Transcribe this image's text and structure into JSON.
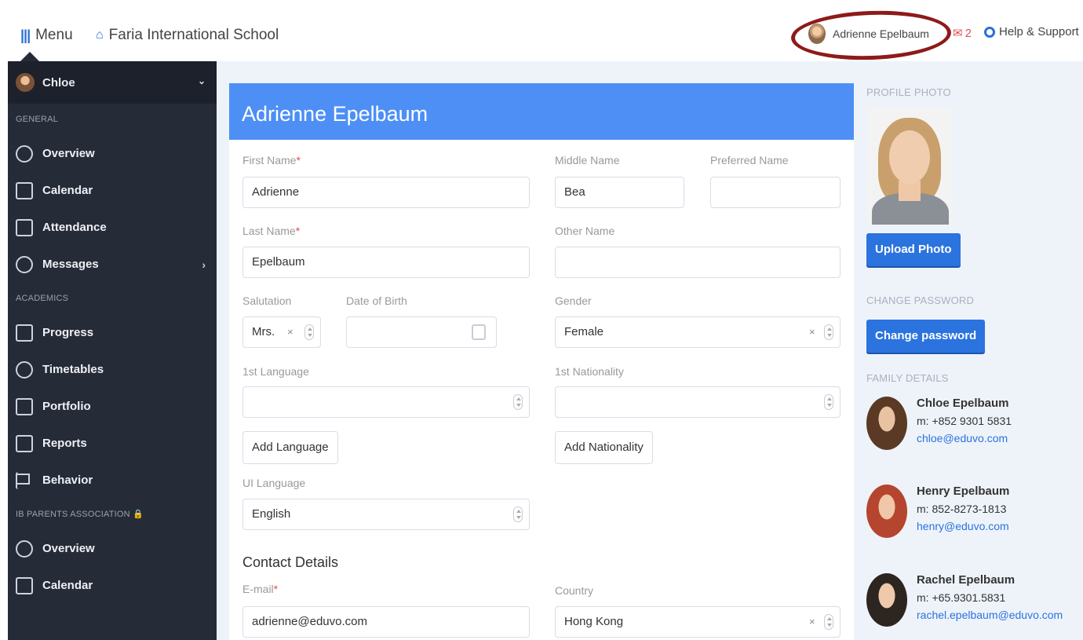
{
  "topbar": {
    "menu_label": "Menu",
    "school_name": "Faria International School",
    "user_name": "Adrienne Epelbaum",
    "notification_count": "2",
    "help_label": "Help & Support"
  },
  "sidebar": {
    "user": "Chloe",
    "sections": {
      "general": "GENERAL",
      "academics": "ACADEMICS",
      "association": "IB PARENTS ASSOCIATION 🔒"
    },
    "general_items": [
      "Overview",
      "Calendar",
      "Attendance",
      "Messages"
    ],
    "academic_items": [
      "Progress",
      "Timetables",
      "Portfolio",
      "Reports",
      "Behavior"
    ],
    "association_items": [
      "Overview",
      "Calendar"
    ]
  },
  "form": {
    "title": "Adrienne Epelbaum",
    "first_name": {
      "label": "First Name",
      "value": "Adrienne"
    },
    "middle_name": {
      "label": "Middle Name",
      "value": "Bea"
    },
    "preferred_name": {
      "label": "Preferred Name",
      "value": ""
    },
    "last_name": {
      "label": "Last Name",
      "value": "Epelbaum"
    },
    "other_name": {
      "label": "Other Name",
      "value": ""
    },
    "salutation": {
      "label": "Salutation",
      "value": "Mrs."
    },
    "dob": {
      "label": "Date of Birth",
      "value": ""
    },
    "gender": {
      "label": "Gender",
      "value": "Female"
    },
    "first_language": {
      "label": "1st Language",
      "value": ""
    },
    "first_nationality": {
      "label": "1st Nationality",
      "value": ""
    },
    "add_language": "Add Language",
    "add_nationality": "Add Nationality",
    "ui_language": {
      "label": "UI Language",
      "value": "English"
    },
    "contact_heading": "Contact Details",
    "email": {
      "label": "E-mail",
      "value": "adrienne@eduvo.com"
    },
    "country": {
      "label": "Country",
      "value": "Hong Kong"
    },
    "required_mark": "*",
    "clear_mark": "×"
  },
  "right_panel": {
    "profile_photo_title": "PROFILE PHOTO",
    "upload_button": "Upload Photo",
    "change_password_title": "CHANGE PASSWORD",
    "change_password_button": "Change password",
    "family_title": "FAMILY DETAILS",
    "family": [
      {
        "name": "Chloe Epelbaum",
        "phone": "m: +852 9301 5831",
        "email": "chloe@eduvo.com"
      },
      {
        "name": "Henry Epelbaum",
        "phone": "m: 852-8273-1813",
        "email": "henry@eduvo.com"
      },
      {
        "name": "Rachel Epelbaum",
        "phone": "m: +65.9301.5831",
        "email": "rachel.epelbaum@eduvo.com"
      }
    ]
  },
  "colors": {
    "accent": "#4d8ff5",
    "button_blue": "#2b73de",
    "sidebar": "#262b38",
    "highlight": "#8e1a1a"
  },
  "icons": [
    "menu-bars-icon",
    "home-icon",
    "mail-icon",
    "help-icon",
    "chevron-down-icon",
    "chevron-right-icon",
    "overview-icon",
    "calendar-icon",
    "attendance-icon",
    "messages-icon",
    "progress-icon",
    "timetables-icon",
    "portfolio-icon",
    "reports-icon",
    "behavior-icon",
    "lock-icon"
  ]
}
